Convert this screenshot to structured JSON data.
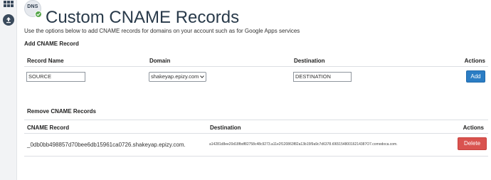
{
  "header": {
    "badge_text": "DNS",
    "title": "Custom CNAME Records"
  },
  "intro_text": "Use the options below to add CNAME records for domains on your account such as for Google Apps services",
  "add_section": {
    "title": "Add CNAME Record",
    "columns": [
      "Record Name",
      "Domain",
      "Destination",
      "Actions"
    ],
    "record_name_value": "SOURCE",
    "domain_selected": "shakeyap.epizy.com",
    "destination_value": "DESTINATION",
    "add_label": "Add"
  },
  "remove_section": {
    "title": "Remove CNAME Records",
    "columns": [
      "CNAME Record",
      "Destination",
      "Actions"
    ],
    "rows": [
      {
        "record": "_0db0bb498857d70bee6db15961ca0726.shakeyap.epizy.com.",
        "destination": "a14281d8ee20d18fbdf82758c48c9273.a11e2f120863f82a13b15f9a9c7d6378.t06515480016214387O7.comodoca.com.",
        "delete_label": "Delete"
      }
    ]
  },
  "colors": {
    "primary": "#2b7dc4",
    "danger": "#d9534f",
    "success": "#56a64a"
  },
  "icons": [
    "grid-icon",
    "upload-icon",
    "dns-icon",
    "check-icon",
    "chevron-down-icon"
  ]
}
